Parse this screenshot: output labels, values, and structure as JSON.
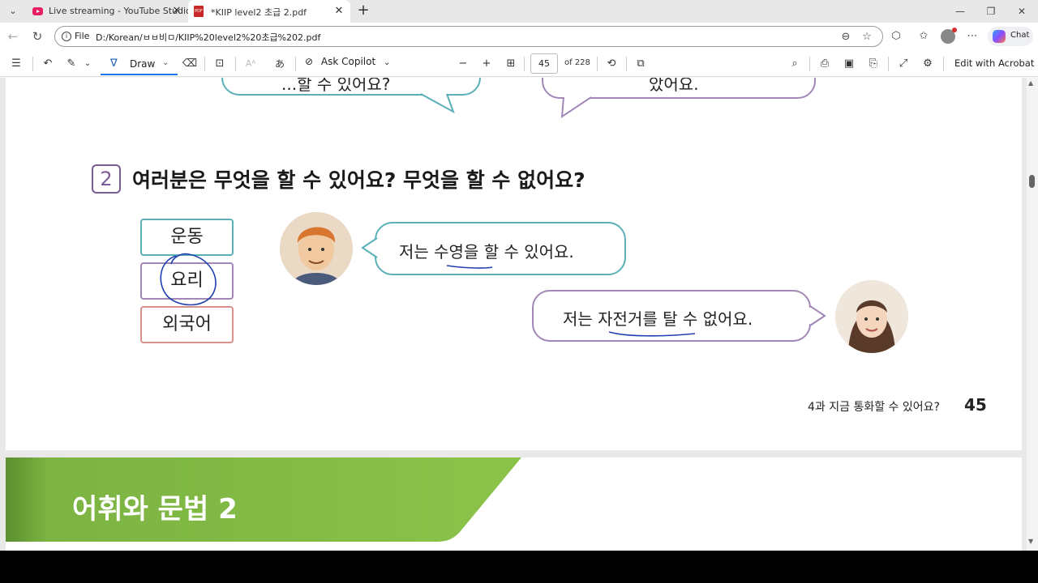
{
  "browser": {
    "tabs": [
      {
        "title": "Live streaming - YouTube Studio",
        "active": false
      },
      {
        "title": "*KIIP level2 초급 2.pdf",
        "active": true
      }
    ],
    "address": {
      "scheme_label": "File",
      "url": "D:/Korean/ㅂㅂ비ㅁ/KIIP%20level2%20초급%202.pdf"
    },
    "chat_label": "Chat"
  },
  "pdf_toolbar": {
    "draw_label": "Draw",
    "ask_copilot_label": "Ask Copilot",
    "page_current": "45",
    "page_total": "of 228",
    "edit_acrobat_label": "Edit with Acrobat"
  },
  "document": {
    "top_bubble_right_text": "았어요.",
    "top_bubble_left_text": "...할 수 있어요?",
    "question_number": "2",
    "question_text": "여러분은 무엇을 할 수 있어요? 무엇을 할 수 없어요?",
    "vocab": [
      "운동",
      "요리",
      "외국어"
    ],
    "speech_man": "저는 수영을 할 수 있어요.",
    "speech_woman": "저는 자전거를 탈 수 없어요.",
    "footer_text": "4과 지금 통화할 수 있어요?",
    "page_number": "45",
    "next_section_title": "어휘와 문법 2"
  },
  "colors": {
    "teal": "#5bb0b8",
    "purple": "#a287b8",
    "salmon": "#d9918e",
    "annotation_blue": "#1f3fb0",
    "banner_green": "#7cb342"
  }
}
